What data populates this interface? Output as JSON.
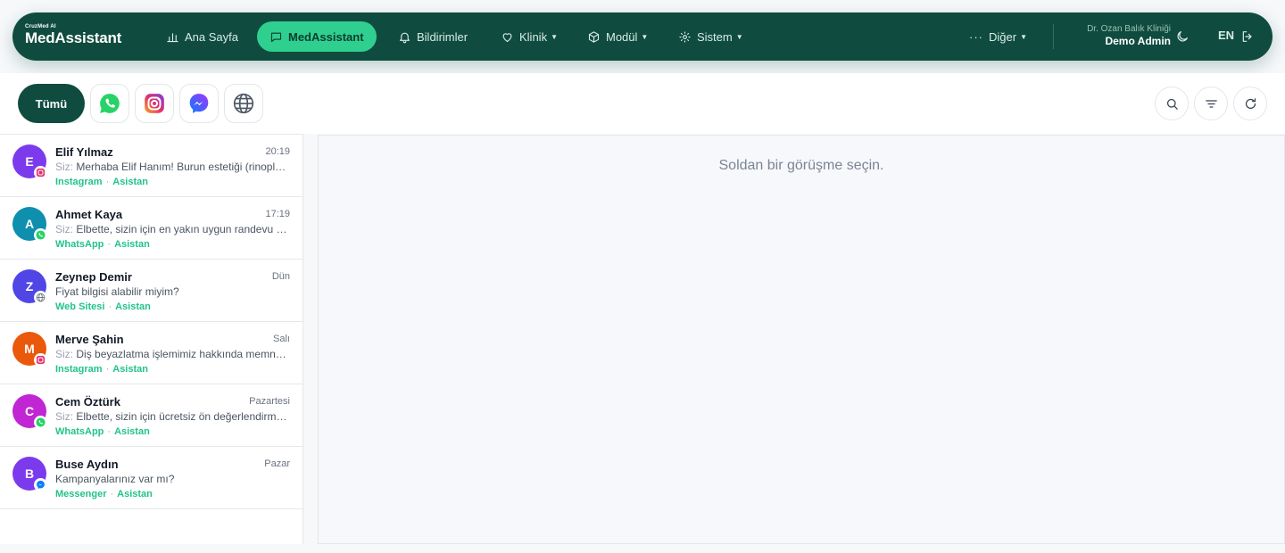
{
  "brand": {
    "small": "CruzMed AI",
    "big": "MedAssistant"
  },
  "nav": [
    {
      "label": "Ana Sayfa",
      "icon": "bar-chart-icon",
      "active": false,
      "caret": false
    },
    {
      "label": "MedAssistant",
      "icon": "message-icon",
      "active": true,
      "caret": false
    },
    {
      "label": "Bildirimler",
      "icon": "bell-icon",
      "active": false,
      "caret": false
    },
    {
      "label": "Klinik",
      "icon": "heart-icon",
      "active": false,
      "caret": true
    },
    {
      "label": "Modül",
      "icon": "cube-icon",
      "active": false,
      "caret": true
    },
    {
      "label": "Sistem",
      "icon": "gear-icon",
      "active": false,
      "caret": true
    }
  ],
  "more": {
    "label": "Diğer",
    "icon": "dots-icon"
  },
  "clinic": {
    "name": "Dr. Ozan Balık Kliniği",
    "user": "Demo Admin"
  },
  "lang": "EN",
  "filters": {
    "all_label": "Tümü",
    "channels": [
      "whatsapp-icon",
      "instagram-icon",
      "messenger-icon",
      "globe-icon"
    ]
  },
  "actions": [
    "search-icon",
    "filter-icon",
    "refresh-icon"
  ],
  "conversations": [
    {
      "initial": "E",
      "color": "#7c3aed",
      "name": "Elif Yılmaz",
      "time": "20:19",
      "prefix": "Siz:",
      "message": "Merhaba Elif Hanım! Burun estetiği (rinoplasti) hakkında bilgi vermekten memnuniyet duyarım.",
      "channel": "Instagram",
      "handler": "Asistan",
      "badge": "instagram"
    },
    {
      "initial": "A",
      "color": "#0e8fae",
      "name": "Ahmet Kaya",
      "time": "17:19",
      "prefix": "Siz:",
      "message": "Elbette, sizin için en yakın uygun randevu saatlerini kontrol ediyorum.",
      "channel": "WhatsApp",
      "handler": "Asistan",
      "badge": "whatsapp"
    },
    {
      "initial": "Z",
      "color": "#4f46e5",
      "name": "Zeynep Demir",
      "time": "Dün",
      "prefix": "",
      "message": "Fiyat bilgisi alabilir miyim?",
      "channel": "Web Sitesi",
      "handler": "Asistan",
      "badge": "web"
    },
    {
      "initial": "M",
      "color": "#ea580c",
      "name": "Merve Şahin",
      "time": "Salı",
      "prefix": "Siz:",
      "message": "Diş beyazlatma işlemimiz hakkında memnuniyetle bilgi verebilirim.",
      "channel": "Instagram",
      "handler": "Asistan",
      "badge": "instagram"
    },
    {
      "initial": "C",
      "color": "#c026d3",
      "name": "Cem Öztürk",
      "time": "Pazartesi",
      "prefix": "Siz:",
      "message": "Elbette, sizin için ücretsiz ön değerlendirme randevusu oluşturabiliriz.",
      "channel": "WhatsApp",
      "handler": "Asistan",
      "badge": "whatsapp"
    },
    {
      "initial": "B",
      "color": "#7c3aed",
      "name": "Buse Aydın",
      "time": "Pazar",
      "prefix": "",
      "message": "Kampanyalarınız var mı?",
      "channel": "Messenger",
      "handler": "Asistan",
      "badge": "messenger"
    }
  ],
  "empty_state": "Soldan bir görüşme seçin."
}
